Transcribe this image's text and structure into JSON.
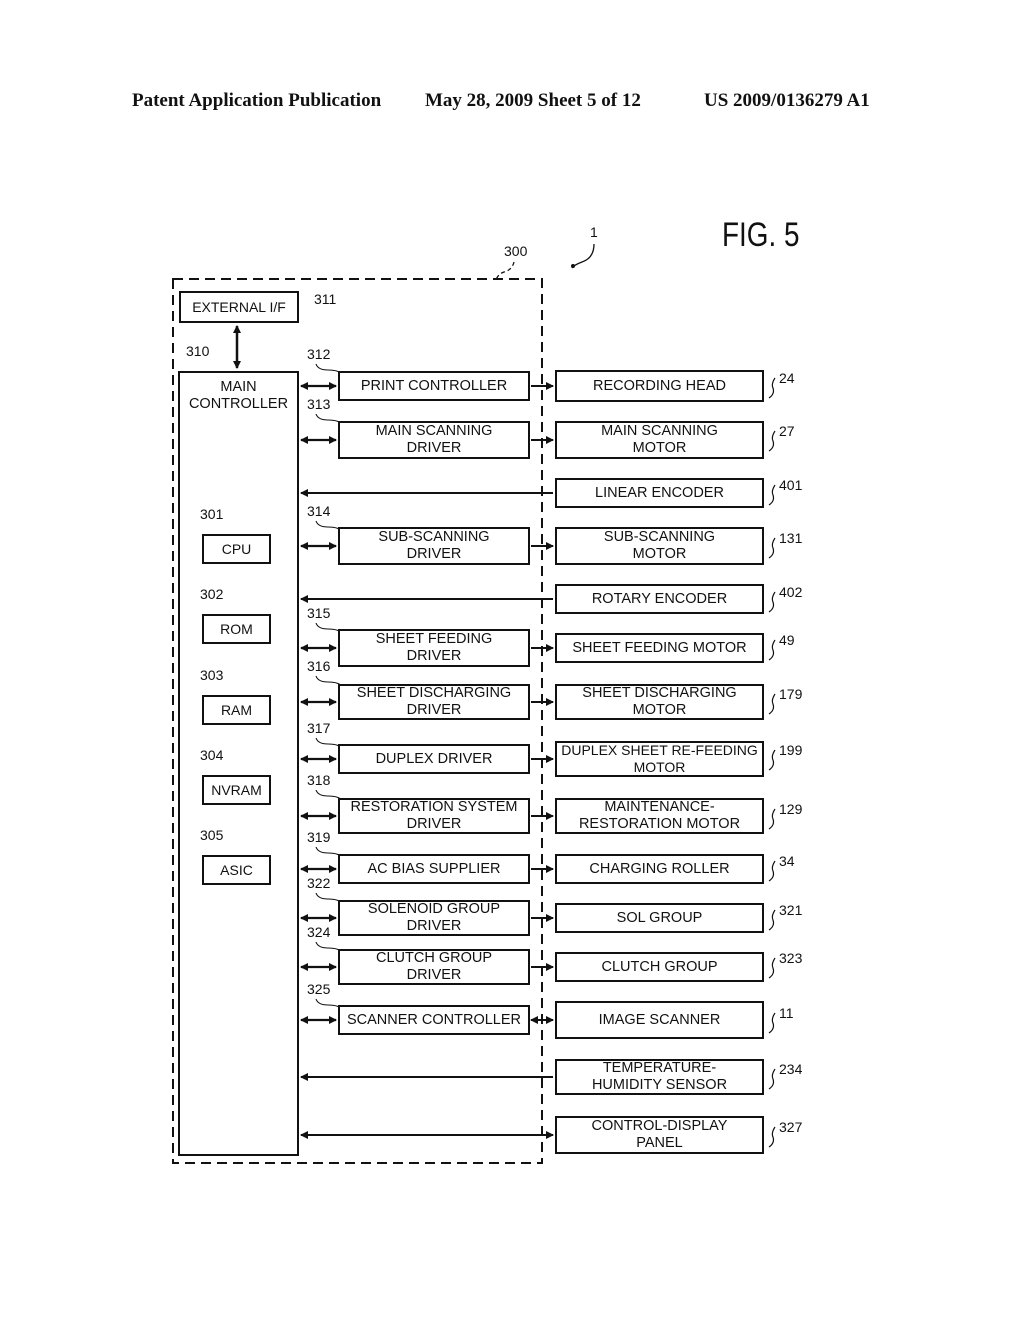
{
  "header": {
    "publication": "Patent Application Publication",
    "date_sheet": "May 28, 2009  Sheet 5 of 12",
    "patent_number": "US 2009/0136279 A1"
  },
  "figure": {
    "label": "FIG. 5",
    "device_ref": "1",
    "control_unit_ref": "300"
  },
  "external_if": {
    "label": "EXTERNAL I/F",
    "ref": "311"
  },
  "main_controller": {
    "label": "MAIN\nCONTROLLER",
    "ref": "310",
    "components": [
      {
        "label": "CPU",
        "ref": "301"
      },
      {
        "label": "ROM",
        "ref": "302"
      },
      {
        "label": "RAM",
        "ref": "303"
      },
      {
        "label": "NVRAM",
        "ref": "304"
      },
      {
        "label": "ASIC",
        "ref": "305"
      }
    ]
  },
  "drivers": [
    {
      "label": "PRINT CONTROLLER",
      "ref": "312"
    },
    {
      "label": "MAIN SCANNING\nDRIVER",
      "ref": "313"
    },
    {
      "label": "SUB-SCANNING\nDRIVER",
      "ref": "314"
    },
    {
      "label": "SHEET FEEDING\nDRIVER",
      "ref": "315"
    },
    {
      "label": "SHEET DISCHARGING\nDRIVER",
      "ref": "316"
    },
    {
      "label": "DUPLEX DRIVER",
      "ref": "317"
    },
    {
      "label": "RESTORATION SYSTEM\nDRIVER",
      "ref": "318"
    },
    {
      "label": "AC BIAS SUPPLIER",
      "ref": "319"
    },
    {
      "label": "SOLENOID GROUP\nDRIVER",
      "ref": "322"
    },
    {
      "label": "CLUTCH GROUP\nDRIVER",
      "ref": "324"
    },
    {
      "label": "SCANNER CONTROLLER",
      "ref": "325"
    }
  ],
  "devices": [
    {
      "label": "RECORDING HEAD",
      "ref": "24"
    },
    {
      "label": "MAIN SCANNING\nMOTOR",
      "ref": "27"
    },
    {
      "label": "LINEAR ENCODER",
      "ref": "401"
    },
    {
      "label": "SUB-SCANNING\nMOTOR",
      "ref": "131"
    },
    {
      "label": "ROTARY ENCODER",
      "ref": "402"
    },
    {
      "label": "SHEET FEEDING MOTOR",
      "ref": "49"
    },
    {
      "label": "SHEET DISCHARGING\nMOTOR",
      "ref": "179"
    },
    {
      "label": "DUPLEX SHEET RE-FEEDING\nMOTOR",
      "ref": "199"
    },
    {
      "label": "MAINTENANCE-\nRESTORATION MOTOR",
      "ref": "129"
    },
    {
      "label": "CHARGING ROLLER",
      "ref": "34"
    },
    {
      "label": "SOL GROUP",
      "ref": "321"
    },
    {
      "label": "CLUTCH GROUP",
      "ref": "323"
    },
    {
      "label": "IMAGE SCANNER",
      "ref": "11"
    },
    {
      "label": "TEMPERATURE-\nHUMIDITY SENSOR",
      "ref": "234"
    },
    {
      "label": "CONTROL-DISPLAY\nPANEL",
      "ref": "327"
    }
  ]
}
